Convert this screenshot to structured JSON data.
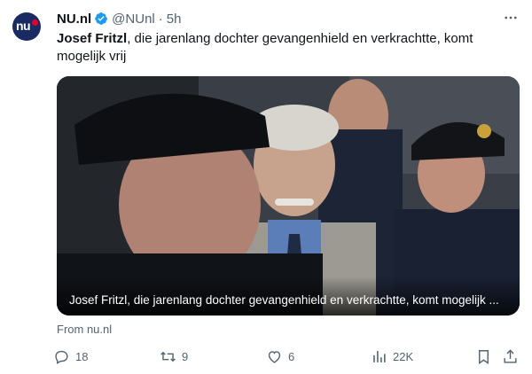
{
  "author": {
    "display_name": "NU.nl",
    "handle": "@NUnl",
    "separator": "·",
    "time": "5h",
    "avatar_text": "nu",
    "avatar_icon": "nu-logo-icon",
    "verified_icon": "verified-badge-icon"
  },
  "tweet": {
    "bold_name": "Josef Fritzl",
    "text_rest": ", die jarenlang dochter gevangenhield en verkrachtte, komt mogelijk vrij"
  },
  "media": {
    "caption": "Josef Fritzl, die jarenlang dochter gevangenhield en verkrachtte, komt mogelijk ..."
  },
  "source": "From nu.nl",
  "actions": {
    "reply_count": "18",
    "retweet_count": "9",
    "like_count": "6",
    "views_count": "22K"
  },
  "colors": {
    "brand": "#1a2a62",
    "accent": "#e4002b",
    "verified": "#1d9bf0",
    "muted": "#536471"
  }
}
